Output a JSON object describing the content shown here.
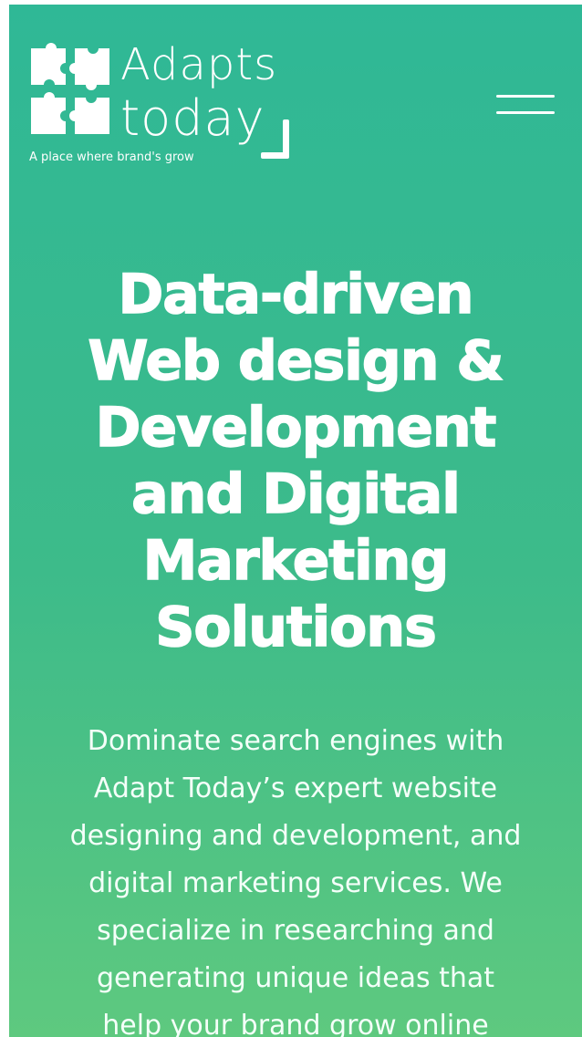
{
  "header": {
    "logo": {
      "word_top": "Adapts",
      "word_bottom": "today",
      "tagline": "A place where brand's grow",
      "puzzle_icon": "puzzle-pieces-icon"
    },
    "menu_icon": "hamburger-icon"
  },
  "hero": {
    "headline_lines": [
      "Data-driven",
      "Web design &",
      "Development",
      "and Digital",
      "Marketing",
      "Solutions"
    ],
    "description_lines": [
      "Dominate search engines with",
      "Adapt Today’s expert website",
      "designing and development, and",
      "digital marketing services. We",
      "specialize in researching and",
      "generating unique ideas that",
      "help your brand grow online"
    ]
  },
  "colors": {
    "gradient_top": "#2fb896",
    "gradient_bottom": "#5ec97f",
    "text": "#ffffff"
  }
}
